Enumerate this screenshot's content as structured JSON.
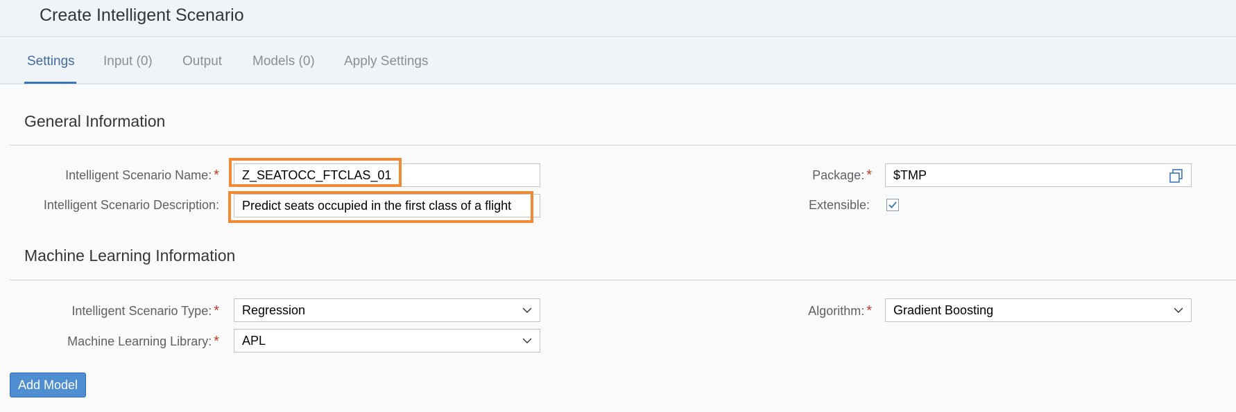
{
  "header": {
    "title": "Create Intelligent Scenario"
  },
  "tabs": [
    {
      "label": "Settings"
    },
    {
      "label": "Input (0)"
    },
    {
      "label": "Output"
    },
    {
      "label": "Models (0)"
    },
    {
      "label": "Apply Settings"
    }
  ],
  "general": {
    "title": "General Information",
    "name_label": "Intelligent Scenario Name:",
    "name_value": "Z_SEATOCC_FTCLAS_01",
    "description_label": "Intelligent Scenario Description:",
    "description_value": "Predict seats occupied in the first class of a flight",
    "package_label": "Package:",
    "package_value": "$TMP",
    "extensible_label": "Extensible:",
    "extensible_checked": true
  },
  "ml": {
    "title": "Machine Learning Information",
    "type_label": "Intelligent Scenario Type:",
    "type_value": "Regression",
    "library_label": "Machine Learning Library:",
    "library_value": "APL",
    "algorithm_label": "Algorithm:",
    "algorithm_value": "Gradient Boosting"
  },
  "actions": {
    "add_model": "Add Model"
  },
  "colors": {
    "highlight": "#f18a34",
    "accent": "#3a74b6",
    "required": "#c0392b"
  }
}
